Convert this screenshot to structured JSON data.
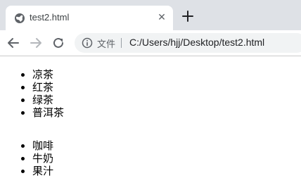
{
  "tab": {
    "title": "test2.html",
    "close_glyph": "✕",
    "favicon_icon": "globe-icon"
  },
  "toolbar": {
    "origin_label": "文件",
    "url": "C:/Users/hjj/Desktop/test2.html"
  },
  "lists": [
    {
      "items": [
        "凉茶",
        "红茶",
        "绿茶",
        "普洱茶"
      ]
    },
    {
      "items": [
        "咖啡",
        "牛奶",
        "果汁"
      ]
    }
  ],
  "colors": {
    "tabstrip_bg": "#dee1e6",
    "omnibox_bg": "#f1f3f4",
    "icon_gray": "#5f6368"
  }
}
